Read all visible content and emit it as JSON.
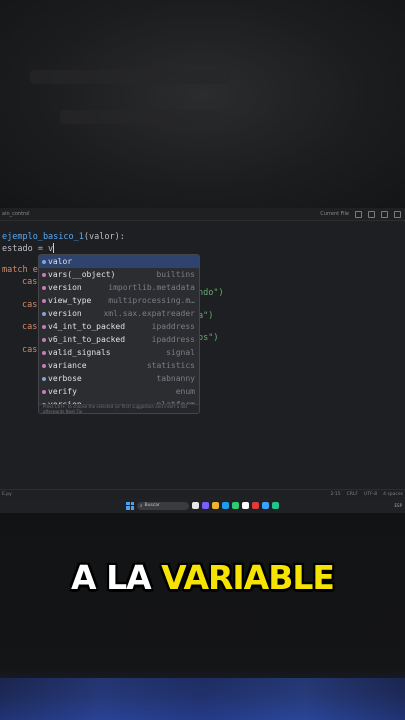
{
  "ide": {
    "toolbar_left": "ain_control",
    "toolbar_run": "Current File",
    "status_left": "E.py",
    "status_right": [
      "2:15",
      "CRLF",
      "UTF-8",
      "4 spaces"
    ]
  },
  "editor": {
    "lines": [
      {
        "kw": "",
        "text": "ejemplo_basico_1",
        "rest": "(valor):"
      },
      {
        "kw": "",
        "text": "estado = v",
        "rest": ""
      },
      {
        "kw": "",
        "text": "match e",
        "rest": ""
      },
      {
        "kw": "",
        "text": "cas",
        "rest": ""
      },
      {
        "kw": "",
        "text": "cas",
        "rest": ""
      },
      {
        "kw": "",
        "text": "cas",
        "rest": ""
      },
      {
        "kw": "",
        "text": "cas",
        "rest": ""
      }
    ],
    "right_frags": [
      "ndo\")",
      "a\")",
      "os\")"
    ]
  },
  "completion": {
    "items": [
      {
        "name": "valor",
        "src": "",
        "selected": true
      },
      {
        "name": "vars(__object)",
        "src": "builtins"
      },
      {
        "name": "version",
        "src": "importlib.metadata"
      },
      {
        "name": "view_type",
        "src": "multiprocessing.m…"
      },
      {
        "name": "version",
        "src": "xml.sax.expatreader"
      },
      {
        "name": "v4_int_to_packed",
        "src": "ipaddress"
      },
      {
        "name": "v6_int_to_packed",
        "src": "ipaddress"
      },
      {
        "name": "valid_signals",
        "src": "signal"
      },
      {
        "name": "variance",
        "src": "statistics"
      },
      {
        "name": "verbose",
        "src": "tabnanny"
      },
      {
        "name": "verify",
        "src": "enum"
      },
      {
        "name": "version",
        "src": "platform"
      }
    ],
    "footer": "Press Ctrl+. to choose the selected (or first) suggestion and insert a dot afterwards  Next Tip"
  },
  "taskbar": {
    "search": "Buscar",
    "tray": "ESP"
  },
  "caption": {
    "part1": "A LA ",
    "part2": "VARIABLE"
  },
  "colors": {
    "caption_highlight": "#f6e400",
    "caption_base": "#ffffff",
    "selection": "#2e436e"
  }
}
